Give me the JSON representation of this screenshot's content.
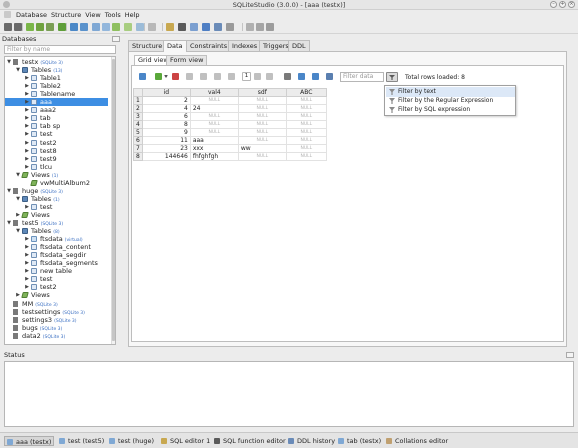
{
  "window": {
    "title": "SQLiteStudio (3.0.0) - [aaa (testx)]",
    "controls": [
      "minimize",
      "maximize",
      "close"
    ]
  },
  "menu": [
    "Database",
    "Structure",
    "View",
    "Tools",
    "Help"
  ],
  "toolbar_icons": [
    {
      "name": "connect-icon",
      "color": "#6a6a6a"
    },
    {
      "name": "disconnect-icon",
      "color": "#6a6a6a"
    },
    {
      "name": "add-database-icon",
      "color": "#7ab648"
    },
    {
      "name": "edit-database-icon",
      "color": "#6fa23f"
    },
    {
      "name": "remove-database-icon",
      "color": "#7a9e55"
    },
    {
      "name": "refresh-icon",
      "color": "#5f9e3a"
    },
    {
      "name": "new-table-icon",
      "color": "#4b88c7"
    },
    {
      "name": "edit-table-icon",
      "color": "#5a92cc"
    },
    {
      "name": "delete-table-icon",
      "color": "#7fa8d4"
    },
    {
      "name": "new-index-icon",
      "color": "#93b7dc"
    },
    {
      "name": "new-trigger-icon",
      "color": "#8fbf5f"
    },
    {
      "name": "new-view-icon",
      "color": "#a8cd80"
    },
    {
      "name": "edit-view-icon",
      "color": "#9cbcd8"
    },
    {
      "name": "sql-editor-icon",
      "color": "#b8b8b8"
    },
    {
      "name": "open-sql-icon",
      "color": "#c8a850"
    },
    {
      "name": "function-icon",
      "color": "#5a5a5a"
    },
    {
      "name": "run-icon",
      "color": "#7b9fd0"
    },
    {
      "name": "collation-icon",
      "color": "#4f7fc4"
    },
    {
      "name": "ddl-history-icon",
      "color": "#6a8bb8"
    },
    {
      "name": "settings-icon",
      "color": "#9a9a9a"
    },
    {
      "name": "tile-icon",
      "color": "#b0b0b0"
    },
    {
      "name": "cascade-icon",
      "color": "#a5a5a5"
    },
    {
      "name": "close-window-icon",
      "color": "#9c9c9c"
    }
  ],
  "databases": {
    "title": "Databases",
    "filter_placeholder": "Filter by name",
    "tree": [
      {
        "label": "testx",
        "type": "db",
        "ver": "(SQLite 3)",
        "expanded": true,
        "level": 0
      },
      {
        "label": "Tables",
        "type": "tables",
        "ver": "(13)",
        "expanded": true,
        "level": 1
      },
      {
        "label": "Table1",
        "type": "table",
        "level": 2
      },
      {
        "label": "Table2",
        "type": "table",
        "level": 2
      },
      {
        "label": "Tablename",
        "type": "table",
        "level": 2
      },
      {
        "label": "aaa",
        "type": "table",
        "level": 2,
        "selected": true
      },
      {
        "label": "aaa2",
        "type": "table",
        "level": 2
      },
      {
        "label": "tab",
        "type": "table",
        "level": 2
      },
      {
        "label": "tab sp",
        "type": "table",
        "level": 2
      },
      {
        "label": "test",
        "type": "table",
        "level": 2
      },
      {
        "label": "test2",
        "type": "table",
        "level": 2
      },
      {
        "label": "test8",
        "type": "table",
        "level": 2
      },
      {
        "label": "test9",
        "type": "table",
        "level": 2
      },
      {
        "label": "tlcu",
        "type": "table",
        "level": 2
      },
      {
        "label": "Views",
        "type": "views",
        "ver": "(1)",
        "expanded": true,
        "level": 1
      },
      {
        "label": "vwMultiAlbum2",
        "type": "view",
        "level": 2
      },
      {
        "label": "huge",
        "type": "db",
        "ver": "(SQLite 3)",
        "expanded": true,
        "level": 0
      },
      {
        "label": "Tables",
        "type": "tables",
        "ver": "(1)",
        "expanded": true,
        "level": 1
      },
      {
        "label": "test",
        "type": "table",
        "level": 2
      },
      {
        "label": "Views",
        "type": "views",
        "level": 1
      },
      {
        "label": "test5",
        "type": "db",
        "ver": "(SQLite 3)",
        "expanded": true,
        "level": 0
      },
      {
        "label": "Tables",
        "type": "tables",
        "ver": "(8)",
        "expanded": true,
        "level": 1
      },
      {
        "label": "ftsdata",
        "type": "vtable",
        "ver": "(virtual)",
        "level": 2
      },
      {
        "label": "ftsdata_content",
        "type": "table",
        "level": 2
      },
      {
        "label": "ftsdata_segdir",
        "type": "table",
        "level": 2
      },
      {
        "label": "ftsdata_segments",
        "type": "table",
        "level": 2
      },
      {
        "label": "new table",
        "type": "table",
        "level": 2
      },
      {
        "label": "test",
        "type": "table",
        "level": 2
      },
      {
        "label": "test2",
        "type": "table",
        "level": 2
      },
      {
        "label": "Views",
        "type": "views",
        "level": 1
      },
      {
        "label": "MM",
        "type": "db",
        "ver": "(SQLite 3)",
        "level": 0
      },
      {
        "label": "testsettings",
        "type": "db",
        "ver": "(SQLite 3)",
        "level": 0
      },
      {
        "label": "settings3",
        "type": "db",
        "ver": "(SQLite 3)",
        "level": 0
      },
      {
        "label": "bugs",
        "type": "db",
        "ver": "(SQLite 3)",
        "level": 0
      },
      {
        "label": "data2",
        "type": "db",
        "ver": "(SQLite 3)",
        "level": 0
      }
    ]
  },
  "main_tabs": [
    "Structure",
    "Data",
    "Constraints",
    "Indexes",
    "Triggers",
    "DDL"
  ],
  "active_main_tab": "Data",
  "sub_tabs": [
    "Grid view",
    "Form view"
  ],
  "active_sub_tab": "Grid view",
  "grid_toolbar_icons": [
    {
      "name": "refresh-data-icon",
      "color": "#4a86c8"
    },
    {
      "name": "commit-icon",
      "color": "#5aa83a"
    },
    {
      "name": "dropdown-arrow-icon",
      "color": "#555555"
    },
    {
      "name": "rollback-icon",
      "color": "#cc4444"
    },
    {
      "name": "insert-row-icon",
      "color": "#c0c0c0"
    },
    {
      "name": "delete-row-icon",
      "color": "#c0c0c0"
    },
    {
      "name": "first-page-icon",
      "color": "#c0c0c0"
    },
    {
      "name": "prev-page-icon",
      "color": "#c0c0c0"
    },
    {
      "name": "page-number-box",
      "color": "#ffffff"
    },
    {
      "name": "next-page-icon",
      "color": "#c0c0c0"
    },
    {
      "name": "last-page-icon",
      "color": "#c0c0c0"
    },
    {
      "name": "export-icon",
      "color": "#7a7a7a"
    },
    {
      "name": "apply-filter-icon",
      "color": "#4a86c8"
    },
    {
      "name": "clear-filter-icon",
      "color": "#4a86c8"
    },
    {
      "name": "filter-settings-icon",
      "color": "#5a7fb0"
    }
  ],
  "page_number": "1",
  "filter": {
    "placeholder": "Filter data",
    "options": [
      "Filter by text",
      "Filter by the Regular Expression",
      "Filter by SQL expression"
    ],
    "highlighted_option": 0
  },
  "total_rows": "Total rows loaded: 8",
  "table": {
    "columns": [
      "id",
      "val4",
      "sdf",
      "ABC"
    ],
    "rows": [
      {
        "rownum": "1",
        "cells": [
          "2",
          "NULL",
          "NULL",
          "NULL"
        ]
      },
      {
        "rownum": "2",
        "cells": [
          "4",
          "24",
          "NULL",
          "NULL"
        ]
      },
      {
        "rownum": "3",
        "cells": [
          "6",
          "NULL",
          "NULL",
          "NULL"
        ]
      },
      {
        "rownum": "4",
        "cells": [
          "8",
          "NULL",
          "NULL",
          "NULL"
        ]
      },
      {
        "rownum": "5",
        "cells": [
          "9",
          "NULL",
          "NULL",
          "NULL"
        ]
      },
      {
        "rownum": "6",
        "cells": [
          "11",
          "aaa",
          "NULL",
          "NULL"
        ]
      },
      {
        "rownum": "7",
        "cells": [
          "23",
          "xxx",
          "ww",
          "NULL"
        ]
      },
      {
        "rownum": "8",
        "cells": [
          "144646",
          "fhfghfgh",
          "NULL",
          "NULL"
        ]
      }
    ]
  },
  "status": {
    "title": "Status"
  },
  "taskbar": [
    {
      "label": "aaa (testx)",
      "active": true,
      "icon_color": "#7fa8d4"
    },
    {
      "label": "test (test5)",
      "icon_color": "#7fa8d4"
    },
    {
      "label": "test (huge)",
      "icon_color": "#7fa8d4"
    },
    {
      "label": "SQL editor 1",
      "icon_color": "#c8a850"
    },
    {
      "label": "SQL function editor",
      "icon_color": "#5a5a5a"
    },
    {
      "label": "DDL history",
      "icon_color": "#6a8bb8"
    },
    {
      "label": "tab (testx)",
      "icon_color": "#7fa8d4"
    },
    {
      "label": "Collations editor",
      "icon_color": "#c0a070"
    }
  ]
}
